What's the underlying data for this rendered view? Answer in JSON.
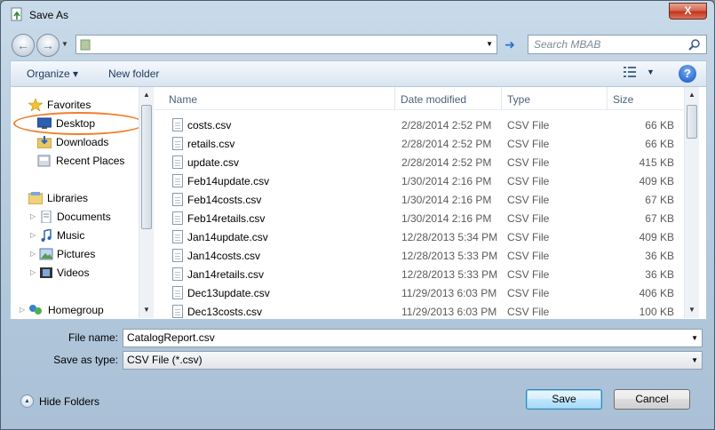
{
  "window": {
    "title": "Save As",
    "close_label": "X"
  },
  "address": {
    "path": "",
    "search_placeholder": "Search MBAB"
  },
  "toolbar": {
    "organize_label": "Organize ▾",
    "new_folder_label": "New folder",
    "help_label": "?"
  },
  "nav": {
    "items": [
      {
        "label": "Favorites",
        "icon": "star-icon"
      },
      {
        "label": "Desktop",
        "icon": "desktop-icon"
      },
      {
        "label": "Downloads",
        "icon": "downloads-icon"
      },
      {
        "label": "Recent Places",
        "icon": "recent-places-icon"
      },
      {
        "label": "Libraries",
        "icon": "libraries-icon"
      },
      {
        "label": "Documents",
        "icon": "documents-icon"
      },
      {
        "label": "Music",
        "icon": "music-icon"
      },
      {
        "label": "Pictures",
        "icon": "pictures-icon"
      },
      {
        "label": "Videos",
        "icon": "videos-icon"
      },
      {
        "label": "Homegroup",
        "icon": "homegroup-icon"
      }
    ]
  },
  "list": {
    "columns": [
      "Name",
      "Date modified",
      "Type",
      "Size"
    ],
    "rows": [
      {
        "name": "costs.csv",
        "date": "2/28/2014 2:52 PM",
        "type": "CSV File",
        "size": "66 KB"
      },
      {
        "name": "retails.csv",
        "date": "2/28/2014 2:52 PM",
        "type": "CSV File",
        "size": "66 KB"
      },
      {
        "name": "update.csv",
        "date": "2/28/2014 2:52 PM",
        "type": "CSV File",
        "size": "415 KB"
      },
      {
        "name": "Feb14update.csv",
        "date": "1/30/2014 2:16 PM",
        "type": "CSV File",
        "size": "409 KB"
      },
      {
        "name": "Feb14costs.csv",
        "date": "1/30/2014 2:16 PM",
        "type": "CSV File",
        "size": "67 KB"
      },
      {
        "name": "Feb14retails.csv",
        "date": "1/30/2014 2:16 PM",
        "type": "CSV File",
        "size": "67 KB"
      },
      {
        "name": "Jan14update.csv",
        "date": "12/28/2013 5:34 PM",
        "type": "CSV File",
        "size": "409 KB"
      },
      {
        "name": "Jan14costs.csv",
        "date": "12/28/2013 5:33 PM",
        "type": "CSV File",
        "size": "36 KB"
      },
      {
        "name": "Jan14retails.csv",
        "date": "12/28/2013 5:33 PM",
        "type": "CSV File",
        "size": "36 KB"
      },
      {
        "name": "Dec13update.csv",
        "date": "11/29/2013 6:03 PM",
        "type": "CSV File",
        "size": "406 KB"
      },
      {
        "name": "Dec13costs.csv",
        "date": "11/29/2013 6:03 PM",
        "type": "CSV File",
        "size": "100 KB"
      }
    ]
  },
  "form": {
    "file_name_label": "File name:",
    "file_name_value": "CatalogReport.csv",
    "save_type_label": "Save as type:",
    "save_type_value": "CSV File (*.csv)"
  },
  "footer": {
    "hide_folders_label": "Hide Folders",
    "save_label": "Save",
    "cancel_label": "Cancel"
  },
  "colors": {
    "highlight_circle": "#f07f2a",
    "accent": "#2e6fd2"
  }
}
